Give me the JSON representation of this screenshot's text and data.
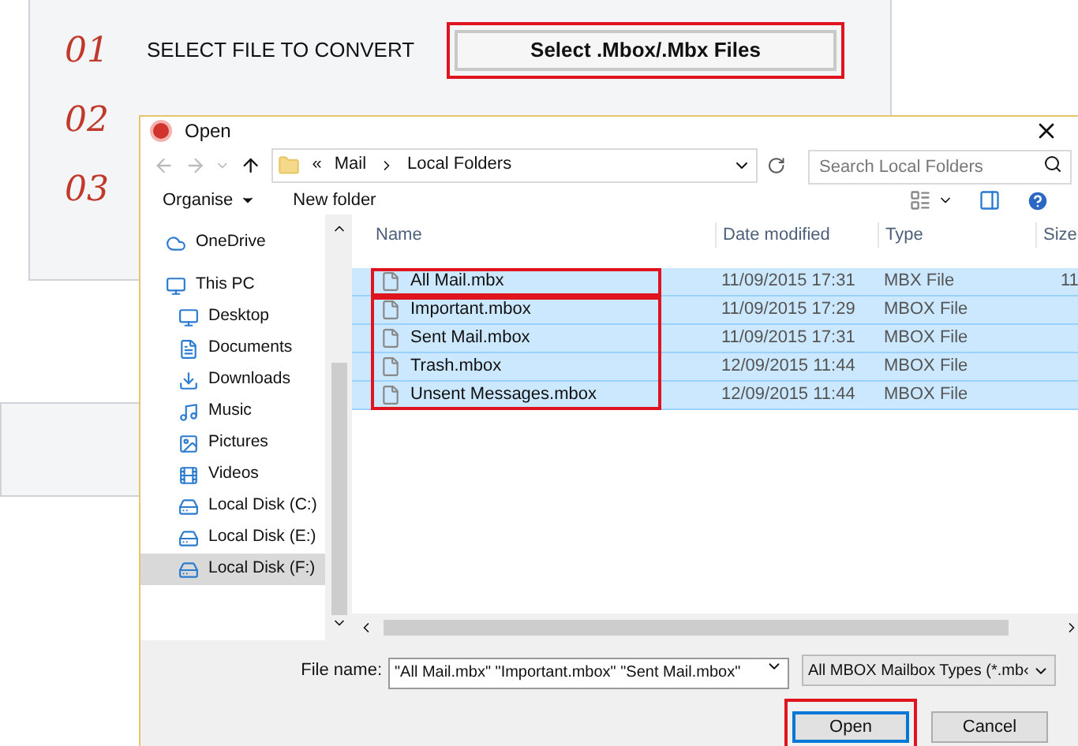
{
  "app": {
    "steps": [
      {
        "number": "01",
        "label": "SELECT FILE TO CONVERT",
        "button": {
          "label": "Select .Mbox/.Mbx Files",
          "framed": true
        }
      },
      {
        "number": "02"
      },
      {
        "number": "03"
      }
    ]
  },
  "dialog": {
    "title": "Open",
    "address": {
      "prefix": "«",
      "path": [
        "Mail",
        "Local Folders"
      ]
    },
    "search": {
      "placeholder": "Search Local Folders"
    },
    "toolbar": {
      "organise": "Organise",
      "new_folder": "New folder"
    },
    "sidebar": {
      "items": [
        {
          "label": "OneDrive",
          "selected": false
        },
        {
          "label": "This PC",
          "selected": false,
          "children": [
            {
              "label": "Desktop",
              "selected": false
            },
            {
              "label": "Documents",
              "selected": false
            },
            {
              "label": "Downloads",
              "selected": false
            },
            {
              "label": "Music",
              "selected": false
            },
            {
              "label": "Pictures",
              "selected": false
            },
            {
              "label": "Videos",
              "selected": false
            },
            {
              "label": "Local Disk (C:)",
              "selected": false
            },
            {
              "label": "Local Disk (E:)",
              "selected": false
            },
            {
              "label": "Local Disk (F:)",
              "selected": true
            }
          ]
        }
      ]
    },
    "table": {
      "columns": [
        "Name",
        "Date modified",
        "Type",
        "Size"
      ],
      "rows": [
        {
          "name": "All Mail.mbx",
          "date": "11/09/2015 17:31",
          "type": "MBX File",
          "size": "11",
          "selected": true,
          "frame_start": true
        },
        {
          "name": "Important.mbox",
          "date": "11/09/2015 17:29",
          "type": "MBOX File",
          "selected": true,
          "frame_start": true
        },
        {
          "name": "Sent Mail.mbox",
          "date": "11/09/2015 17:31",
          "type": "MBOX File",
          "selected": true,
          "frame_start": false
        },
        {
          "name": "Trash.mbox",
          "date": "12/09/2015 11:44",
          "type": "MBOX File",
          "selected": true,
          "frame_start": false
        },
        {
          "name": "Unsent Messages.mbox",
          "date": "12/09/2015 11:44",
          "type": "MBOX File",
          "selected": true,
          "frame_start": false
        }
      ]
    },
    "file_name": {
      "label": "File name:",
      "value": "\"All Mail.mbx\" \"Important.mbox\" \"Sent Mail.mbox\""
    },
    "file_type": {
      "value": "All MBOX Mailbox Types (*.mb‹"
    },
    "buttons": [
      {
        "label": "Open",
        "kind": "primary",
        "framed": true
      },
      {
        "label": "Cancel",
        "kind": "normal",
        "framed": false
      }
    ]
  }
}
